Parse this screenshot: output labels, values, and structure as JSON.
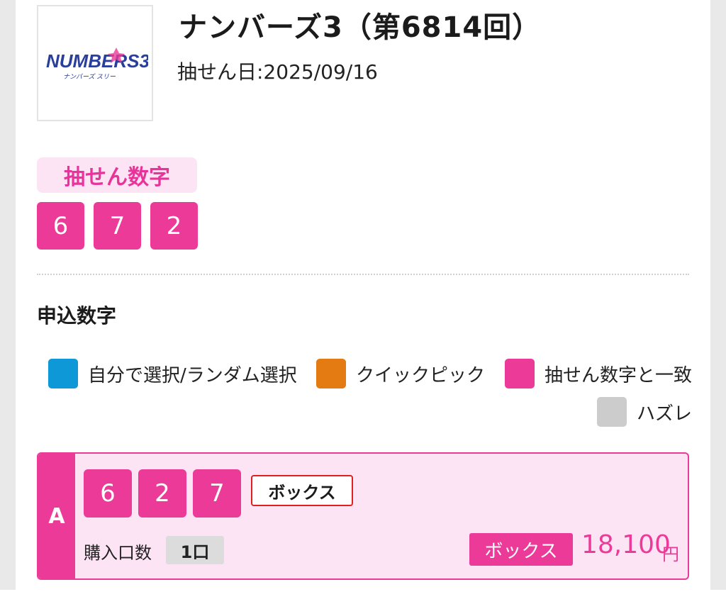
{
  "header": {
    "logo_text": "NUMBERS3",
    "logo_subtext": "ナンバーズ スリー",
    "title": "ナンバーズ3（第6814回）",
    "draw_date": "抽せん日:2025/09/16"
  },
  "winning": {
    "label": "抽せん数字",
    "numbers": [
      "6",
      "7",
      "2"
    ]
  },
  "applied": {
    "section_title": "申込数字",
    "legend": [
      {
        "label": "自分で選択/ランダム選択",
        "color": "#0e98d8"
      },
      {
        "label": "クイックピック",
        "color": "#e47b12"
      },
      {
        "label": "抽せん数字と一致",
        "color": "#ec3a99"
      },
      {
        "label": "ハズレ",
        "color": "#cccccc"
      }
    ]
  },
  "entry": {
    "letter": "A",
    "numbers": [
      "6",
      "2",
      "7"
    ],
    "mode": "ボックス",
    "quantity_label": "購入口数",
    "quantity_value": "1口",
    "prize_type": "ボックス",
    "prize_amount": "18,100",
    "prize_unit": "円"
  },
  "colors": {
    "accent": "#ec3a99",
    "accent_light": "#fde4f5",
    "self_select": "#0e98d8",
    "quick_pick": "#e47b12",
    "miss": "#cccccc"
  }
}
